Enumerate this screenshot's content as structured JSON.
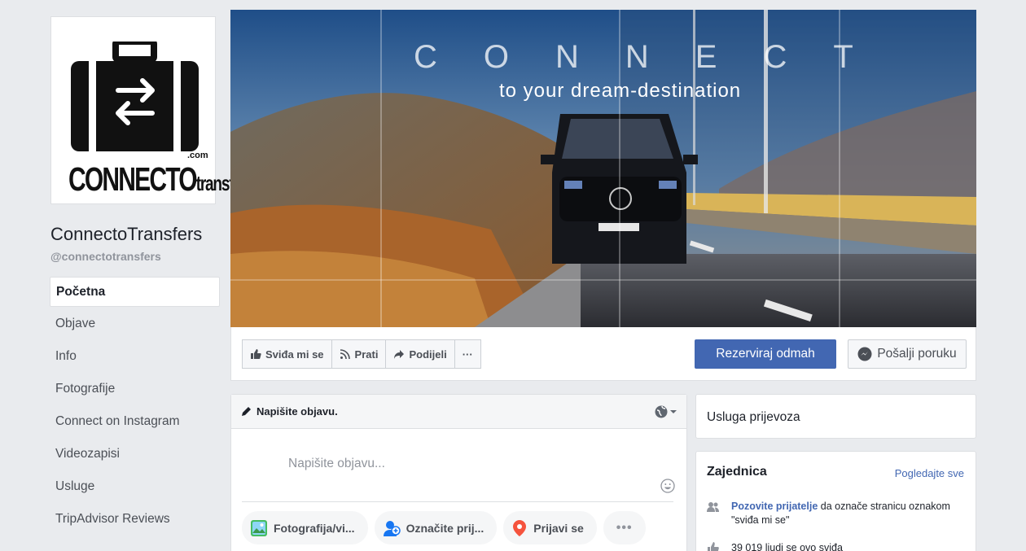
{
  "page": {
    "name": "ConnectoTransfers",
    "handle": "@connectotransfers",
    "logo_text_main": "CONNECTO",
    "logo_text_sub": "transfers",
    "logo_dotcom": ".com"
  },
  "nav": {
    "items": [
      {
        "label": "Početna",
        "active": true
      },
      {
        "label": "Objave"
      },
      {
        "label": "Info"
      },
      {
        "label": "Fotografije"
      },
      {
        "label": "Connect on Instagram"
      },
      {
        "label": "Videozapisi"
      },
      {
        "label": "Usluge"
      },
      {
        "label": "TripAdvisor Reviews"
      }
    ]
  },
  "cover": {
    "headline": "CONNECT",
    "tagline": "to your dream-destination"
  },
  "actions": {
    "like_label": "Sviđa mi se",
    "follow_label": "Prati",
    "share_label": "Podijeli",
    "more_label": "···",
    "book_label": "Rezerviraj odmah",
    "message_label": "Pošalji poruku"
  },
  "composer": {
    "header_label": "Napišite objavu.",
    "placeholder": "Napišite objavu...",
    "actions": [
      {
        "label": "Fotografija/vi...",
        "icon": "photo-icon"
      },
      {
        "label": "Označite prij...",
        "icon": "tag-friends-icon"
      },
      {
        "label": "Prijavi se",
        "icon": "location-pin-icon"
      }
    ],
    "more_label": "•••"
  },
  "sidebar": {
    "category": "Usluga prijevoza",
    "community": {
      "title": "Zajednica",
      "see_all": "Pogledajte sve",
      "invite_link": "Pozovite prijatelje",
      "invite_text": "da označe stranicu oznakom \"sviđa mi se\"",
      "likes_text": "39 019 ljudi se ovo sviđa"
    }
  },
  "colors": {
    "brand_blue": "#4267b2",
    "background": "#e9ebee"
  }
}
